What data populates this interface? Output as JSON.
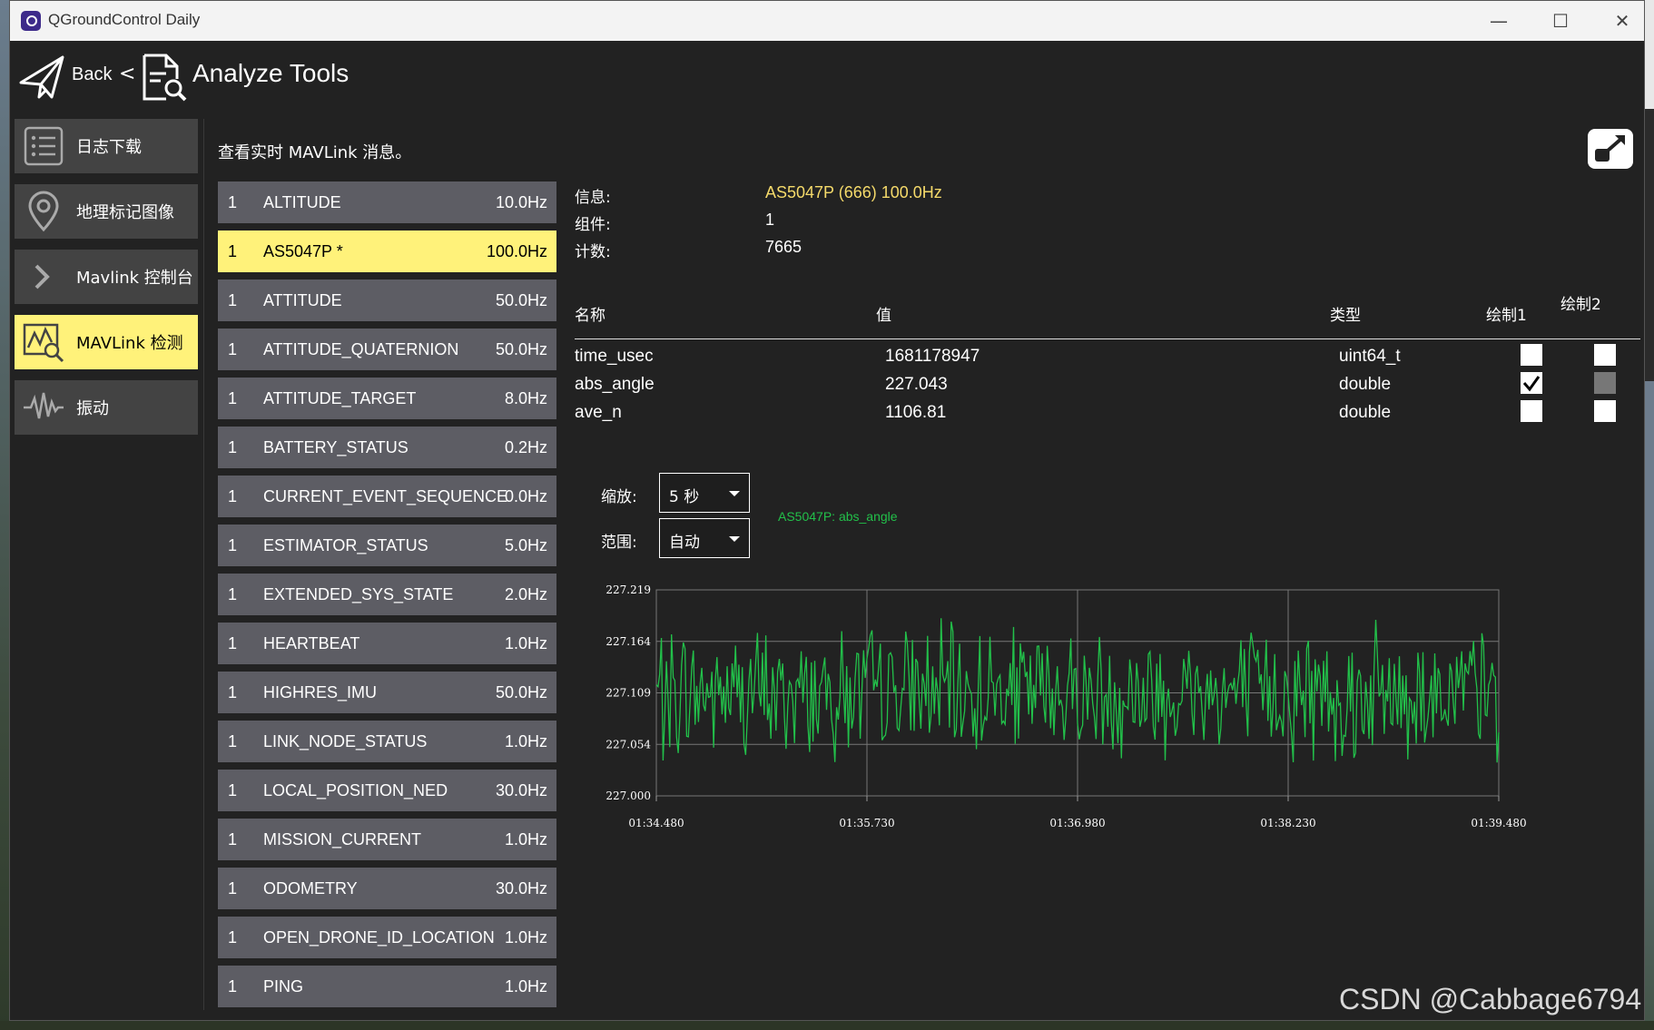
{
  "window": {
    "title": "QGroundControl Daily",
    "controls": [
      "—",
      "☐",
      "✕"
    ]
  },
  "toolbar": {
    "back_label": "Back",
    "separator": "<",
    "page_title": "Analyze Tools"
  },
  "sidebar": {
    "items": [
      {
        "label": "日志下载",
        "icon": "list-icon",
        "active": false
      },
      {
        "label": "地理标记图像",
        "icon": "map-pin-icon",
        "active": false
      },
      {
        "label": "Mavlink 控制台",
        "icon": "chevron-right-icon",
        "active": false
      },
      {
        "label": "MAVLink 检测",
        "icon": "chart-inspect-icon",
        "active": true
      },
      {
        "label": "振动",
        "icon": "vibration-icon",
        "active": false
      }
    ]
  },
  "main": {
    "subtitle": "查看实时 MAVLink 消息。"
  },
  "messages": [
    {
      "comp": "1",
      "name": "ALTITUDE",
      "rate": "10.0Hz",
      "selected": false
    },
    {
      "comp": "1",
      "name": "AS5047P *",
      "rate": "100.0Hz",
      "selected": true
    },
    {
      "comp": "1",
      "name": "ATTITUDE",
      "rate": "50.0Hz",
      "selected": false
    },
    {
      "comp": "1",
      "name": "ATTITUDE_QUATERNION",
      "rate": "50.0Hz",
      "selected": false
    },
    {
      "comp": "1",
      "name": "ATTITUDE_TARGET",
      "rate": "8.0Hz",
      "selected": false
    },
    {
      "comp": "1",
      "name": "BATTERY_STATUS",
      "rate": "0.2Hz",
      "selected": false
    },
    {
      "comp": "1",
      "name": "CURRENT_EVENT_SEQUENCE",
      "rate": "0.0Hz",
      "selected": false
    },
    {
      "comp": "1",
      "name": "ESTIMATOR_STATUS",
      "rate": "5.0Hz",
      "selected": false
    },
    {
      "comp": "1",
      "name": "EXTENDED_SYS_STATE",
      "rate": "2.0Hz",
      "selected": false
    },
    {
      "comp": "1",
      "name": "HEARTBEAT",
      "rate": "1.0Hz",
      "selected": false
    },
    {
      "comp": "1",
      "name": "HIGHRES_IMU",
      "rate": "50.0Hz",
      "selected": false
    },
    {
      "comp": "1",
      "name": "LINK_NODE_STATUS",
      "rate": "1.0Hz",
      "selected": false
    },
    {
      "comp": "1",
      "name": "LOCAL_POSITION_NED",
      "rate": "30.0Hz",
      "selected": false
    },
    {
      "comp": "1",
      "name": "MISSION_CURRENT",
      "rate": "1.0Hz",
      "selected": false
    },
    {
      "comp": "1",
      "name": "ODOMETRY",
      "rate": "30.0Hz",
      "selected": false
    },
    {
      "comp": "1",
      "name": "OPEN_DRONE_ID_LOCATION",
      "rate": "1.0Hz",
      "selected": false
    },
    {
      "comp": "1",
      "name": "PING",
      "rate": "1.0Hz",
      "selected": false
    }
  ],
  "details": {
    "message_label": "信息:",
    "message_value": "AS5047P (666) 100.0Hz",
    "component_label": "组件:",
    "component_value": "1",
    "count_label": "计数:",
    "count_value": "7665"
  },
  "fields_table": {
    "headers": {
      "name": "名称",
      "value": "值",
      "type": "类型",
      "plot1": "绘制1",
      "plot2": "绘制2"
    },
    "rows": [
      {
        "name": "time_usec",
        "value": "1681178947",
        "type": "uint64_t",
        "plot1": false,
        "plot2": false,
        "plot2_enabled": true
      },
      {
        "name": "abs_angle",
        "value": "227.043",
        "type": "double",
        "plot1": true,
        "plot2": false,
        "plot2_enabled": false
      },
      {
        "name": "ave_n",
        "value": "1106.81",
        "type": "double",
        "plot1": false,
        "plot2": false,
        "plot2_enabled": true
      }
    ]
  },
  "plot_controls": {
    "zoom_label": "缩放:",
    "zoom_value": "5 秒",
    "range_label": "范围:",
    "range_value": "自动"
  },
  "colors": {
    "accent": "#fff27a",
    "series": "#22c04a",
    "message_highlight": "#f5da6a"
  },
  "watermark": "CSDN @Cabbage6794",
  "chart_data": {
    "type": "line",
    "series": [
      {
        "name": "AS5047P: abs_angle",
        "color": "#22c04a"
      }
    ],
    "ylim": [
      227.0,
      227.219
    ],
    "yticks": [
      "227.219",
      "227.164",
      "227.109",
      "227.054",
      "227.000"
    ],
    "xticks": [
      "01:34.480",
      "01:35.730",
      "01:36.980",
      "01:38.230",
      "01:39.480"
    ],
    "grid": true,
    "sample_rate_hz": 100,
    "duration_s": 5,
    "center": 227.109,
    "noise_amplitude": 0.07
  }
}
